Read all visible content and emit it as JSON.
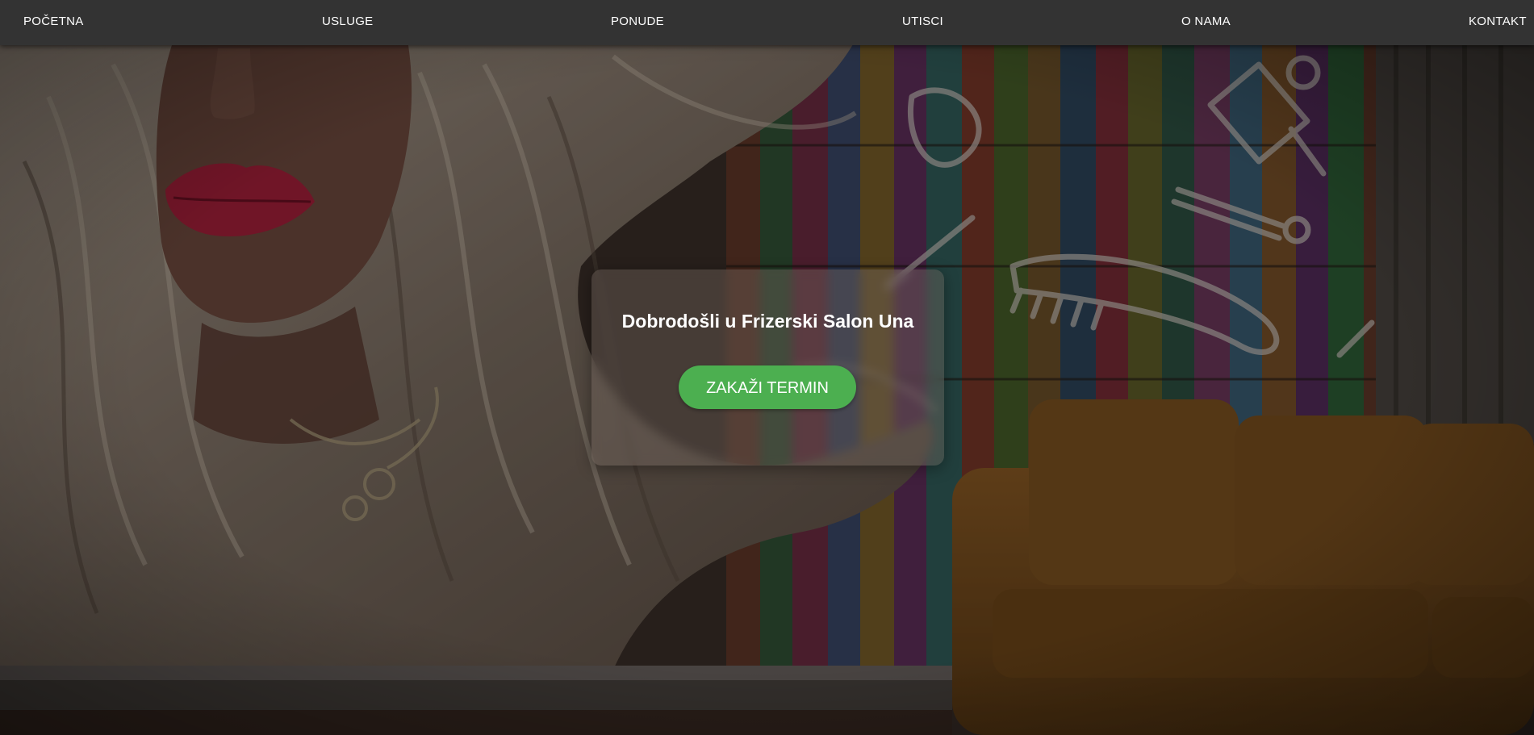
{
  "nav": {
    "items": [
      {
        "label": "POČETNA"
      },
      {
        "label": "USLUGE"
      },
      {
        "label": "PONUDE"
      },
      {
        "label": "UTISCI"
      },
      {
        "label": "O NAMA"
      },
      {
        "label": "KONTAKT"
      }
    ]
  },
  "hero": {
    "title": "Dobrodošli u Frizerski Salon Una",
    "cta_label": "ZAKAŽI TERMIN"
  },
  "colors": {
    "navbar_bg": "#333333",
    "nav_text": "#ffffff",
    "cta_bg": "#4caf50",
    "card_bg": "rgba(120,108,100,0.38)"
  },
  "icons": {
    "background_motifs": [
      "hair-dryer-icon",
      "comb-icon",
      "scissors-icon",
      "straightener-icon"
    ]
  }
}
